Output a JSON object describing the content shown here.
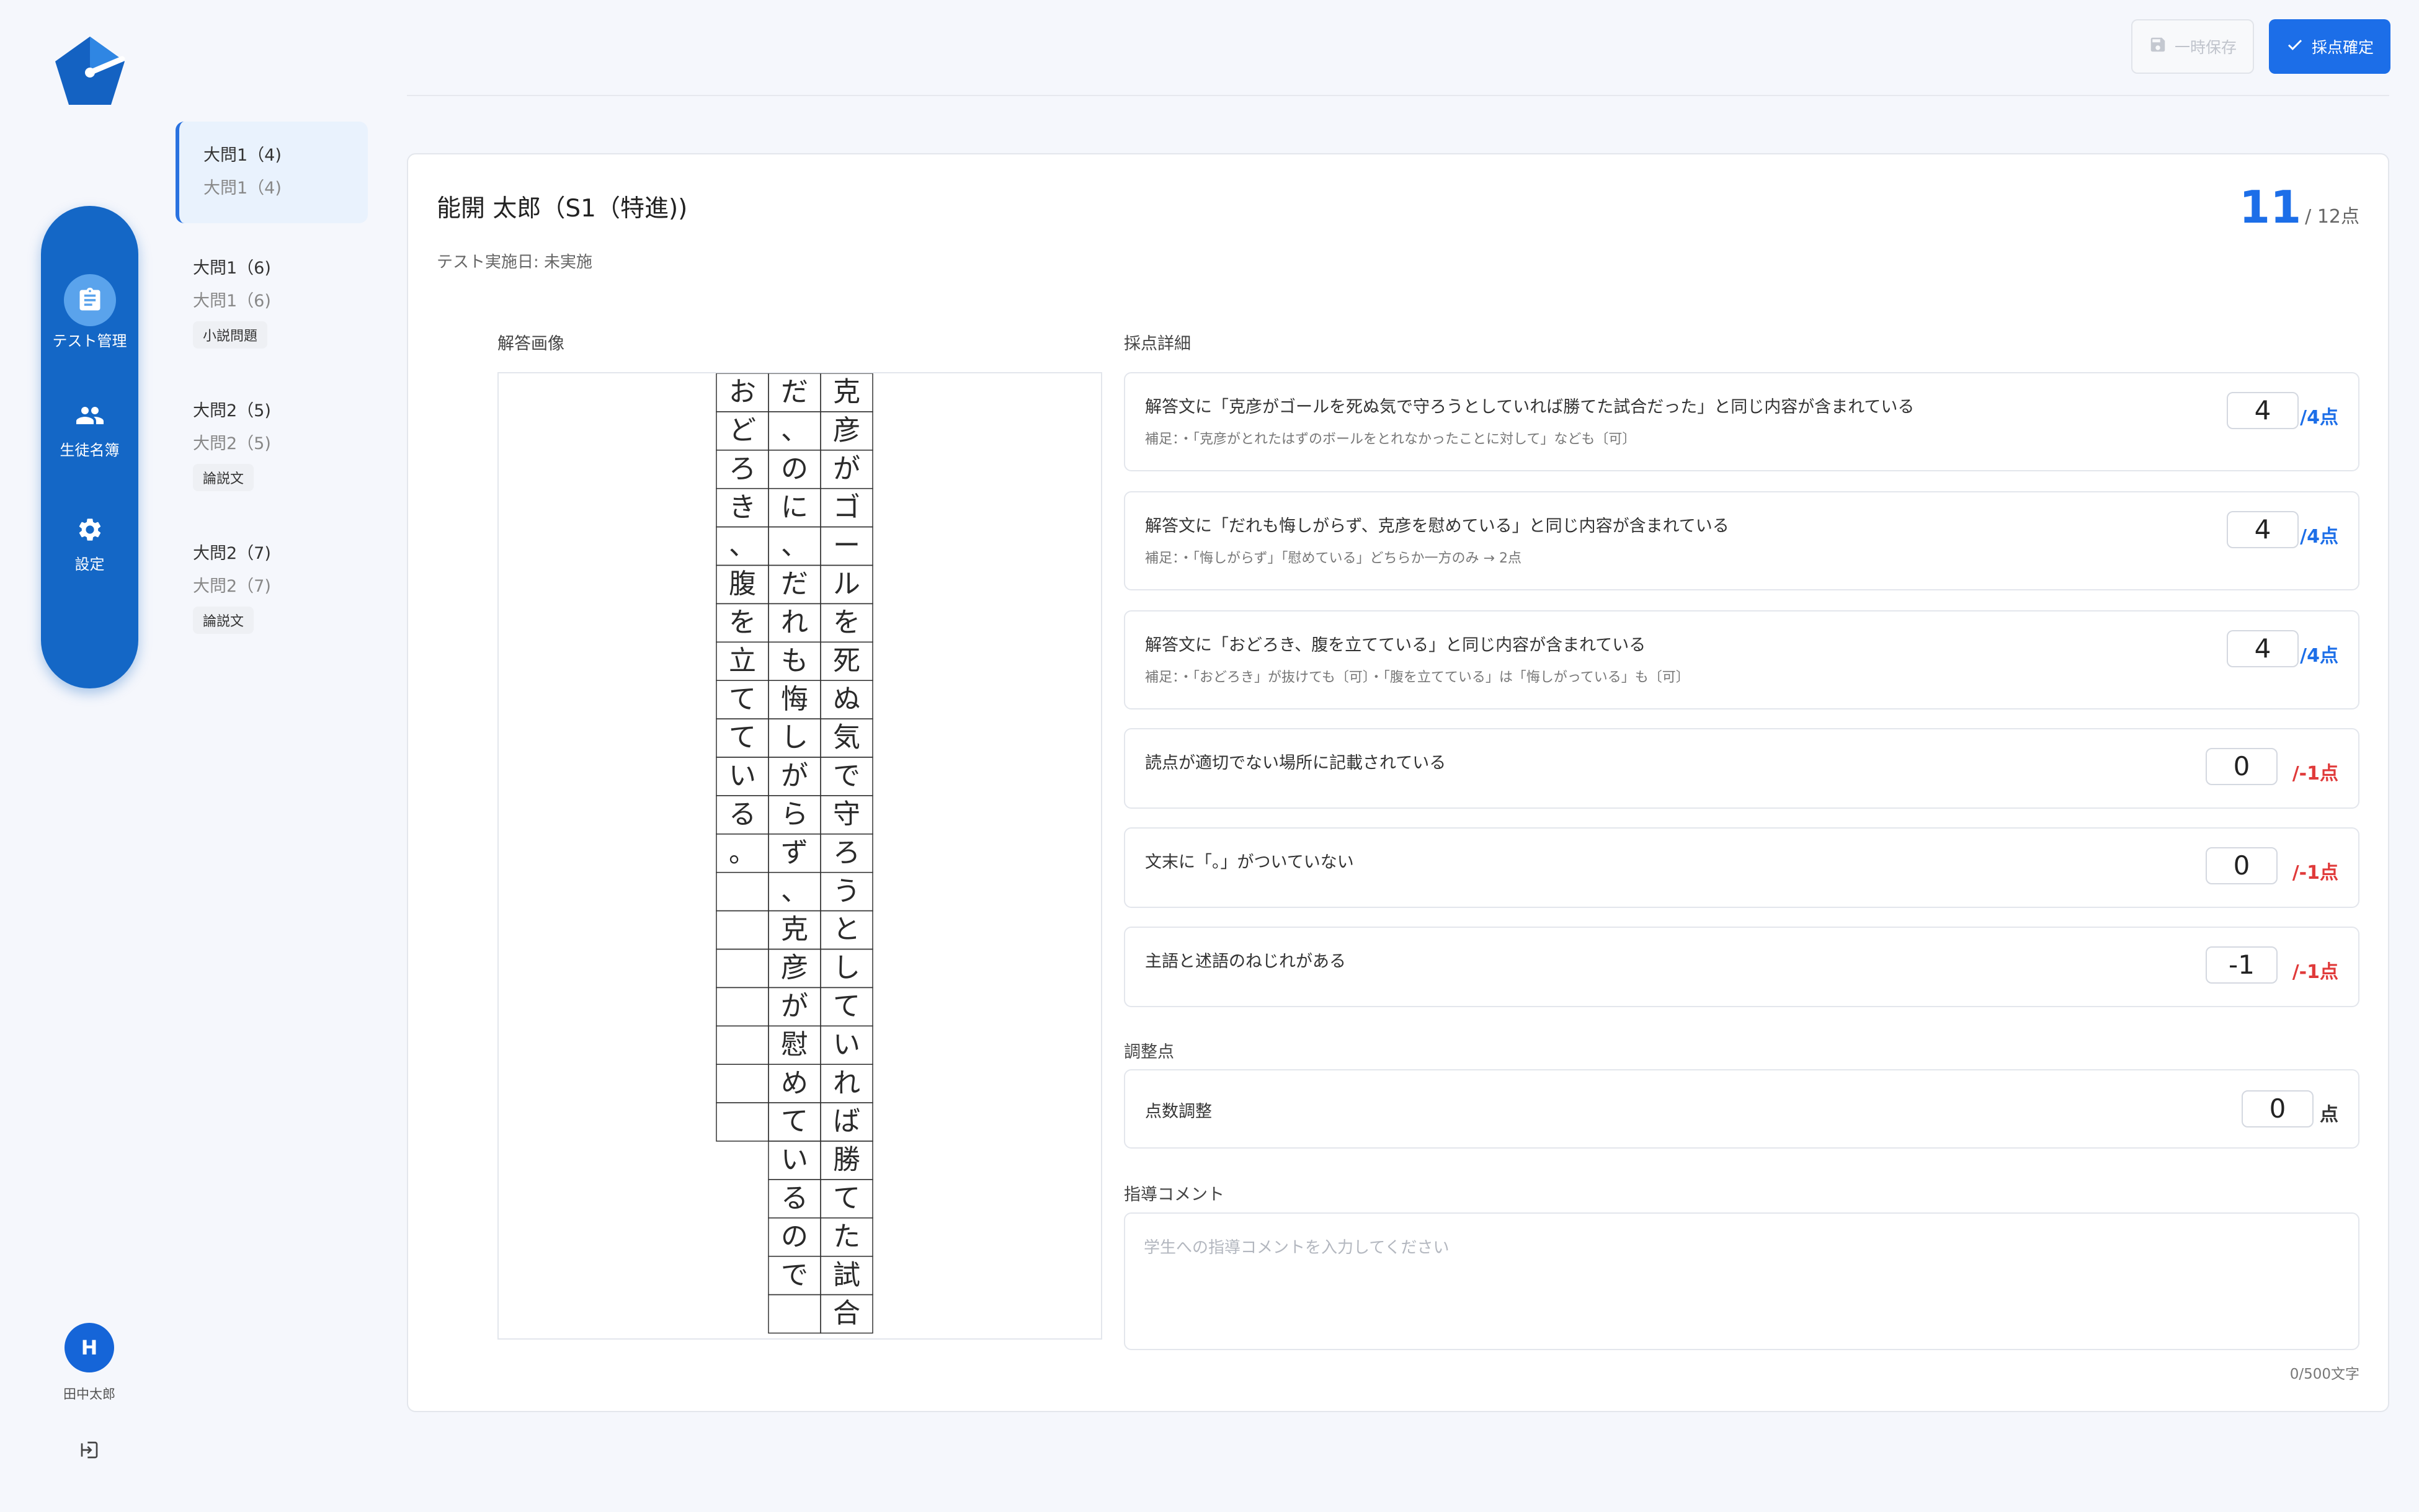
{
  "nav": {
    "items": [
      {
        "label": "テスト管理",
        "icon": "clipboard-icon",
        "active": true
      },
      {
        "label": "生徒名簿",
        "icon": "people-icon",
        "active": false
      },
      {
        "label": "設定",
        "icon": "gear-icon",
        "active": false
      }
    ],
    "user": {
      "initial": "H",
      "name": "田中太郎"
    }
  },
  "questions": [
    {
      "title": "大問1（4)",
      "subtitle": "大問1（4)",
      "tag": "",
      "active": true
    },
    {
      "title": "大問1（6)",
      "subtitle": "大問1（6)",
      "tag": "小説問題",
      "active": false
    },
    {
      "title": "大問2（5)",
      "subtitle": "大問2（5)",
      "tag": "論説文",
      "active": false
    },
    {
      "title": "大問2（7)",
      "subtitle": "大問2（7)",
      "tag": "論説文",
      "active": false
    }
  ],
  "toolbar": {
    "save_label": "一時保存",
    "confirm_label": "採点確定"
  },
  "header": {
    "student": "能開 太郎（S1（特進))",
    "test_date": "テスト実施日: 未実施",
    "score": "11",
    "score_max": "/ 12点"
  },
  "answer_image": {
    "label": "解答画像",
    "columns": [
      "克彦がゴールを死ぬ気で守ろうとしていれば勝てた試合",
      "だ、のに、だれも悔しがらず、克彦が慰めているので",
      "おどろき、腹を立てている。"
    ]
  },
  "details": {
    "label": "採点詳細",
    "criteria": [
      {
        "text": "解答文に「克彦がゴールを死ぬ気で守ろうとしていれば勝てた試合だった」と同じ内容が含まれている",
        "note": "補足：・「克彦がとれたはずのボールをとれなかったことに対して」なども〔可〕",
        "value": "4",
        "max": "/4点",
        "kind": "blue"
      },
      {
        "text": "解答文に「だれも悔しがらず、克彦を慰めている」と同じ内容が含まれている",
        "note": "補足：・「悔しがらず」「慰めている」どちらか一方のみ → 2点",
        "value": "4",
        "max": "/4点",
        "kind": "blue"
      },
      {
        "text": "解答文に「おどろき、腹を立てている」と同じ内容が含まれている",
        "note": "補足：・「おどろき」が抜けても〔可〕・「腹を立てている」は「悔しがっている」も〔可〕",
        "value": "4",
        "max": "/4点",
        "kind": "blue"
      },
      {
        "text": "読点が適切でない場所に記載されている",
        "note": "",
        "value": "0",
        "max": "/-1点",
        "kind": "red"
      },
      {
        "text": "文末に「。」がついていない",
        "note": "",
        "value": "0",
        "max": "/-1点",
        "kind": "red"
      },
      {
        "text": "主語と述語のねじれがある",
        "note": "",
        "value": "-1",
        "max": "/-1点",
        "kind": "red"
      }
    ]
  },
  "adjust": {
    "label": "調整点",
    "item": "点数調整",
    "value": "0",
    "unit": "点"
  },
  "comment": {
    "label": "指導コメント",
    "placeholder": "学生への指導コメントを入力してください",
    "counter": "0/500文字"
  },
  "colors": {
    "accent": "#1c6ee8",
    "nav": "#1467c6",
    "negative": "#e03a3a",
    "background": "#f5f7fc"
  }
}
